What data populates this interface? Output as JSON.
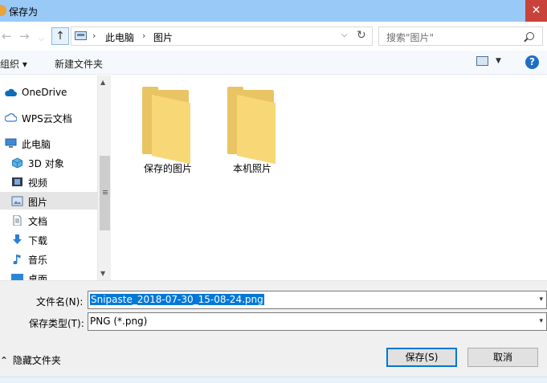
{
  "window": {
    "title": "保存为",
    "close_glyph": "✕"
  },
  "nav": {
    "back_glyph": "←",
    "forward_glyph": "→",
    "up_glyph": "↑",
    "breadcrumb": [
      "此电脑",
      "图片"
    ],
    "breadcrumb_sep": "›",
    "dropdown_glyph": "⌵",
    "refresh_glyph": "↻",
    "search_placeholder": "搜索\"图片\""
  },
  "toolbar": {
    "organize_label": "组织 ▾",
    "new_folder_label": "新建文件夹",
    "view_dropdown_glyph": "▼",
    "help_glyph": "?"
  },
  "sidebar": {
    "items": [
      {
        "label": "OneDrive",
        "icon": "cloud-icon"
      },
      {
        "label": "WPS云文档",
        "icon": "cloud-outline-icon"
      },
      {
        "label": "此电脑",
        "icon": "computer-icon"
      },
      {
        "label": "3D 对象",
        "icon": "cube-3d-icon"
      },
      {
        "label": "视频",
        "icon": "video-icon"
      },
      {
        "label": "图片",
        "icon": "pictures-icon",
        "selected": true
      },
      {
        "label": "文档",
        "icon": "document-icon"
      },
      {
        "label": "下载",
        "icon": "download-icon"
      },
      {
        "label": "音乐",
        "icon": "music-icon"
      },
      {
        "label": "桌面",
        "icon": "desktop-icon"
      }
    ],
    "scroll_up_glyph": "▲",
    "scroll_down_glyph": "▼"
  },
  "folders": [
    {
      "name": "保存的图片"
    },
    {
      "name": "本机照片"
    }
  ],
  "form": {
    "filename_label": "文件名(N):",
    "filename_value": "Snipaste_2018-07-30_15-08-24.png",
    "filetype_label": "保存类型(T):",
    "filetype_value": "PNG (*.png)",
    "dropdown_glyph": "▾"
  },
  "footer": {
    "hide_folders_label": "隐藏文件夹",
    "hide_folders_glyph": "⌃",
    "save_label": "保存(S)",
    "cancel_label": "取消"
  },
  "colors": {
    "titlebar": "#99c9f7",
    "close_button": "#c8423b",
    "selection": "#0078d7",
    "folder": "#f8d876"
  }
}
